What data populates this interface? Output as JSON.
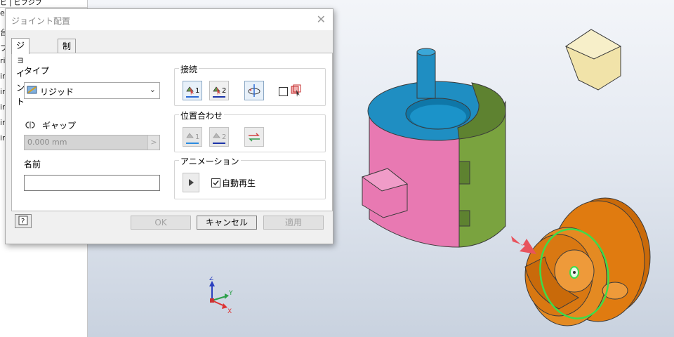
{
  "browser": {
    "top_text": "ビ | ビフジフ",
    "fragments": [
      "e",
      "台",
      "プ",
      "ri",
      "ir",
      "ir",
      "ir",
      "ir",
      "ir"
    ]
  },
  "dialog": {
    "title": "ジョイント配置",
    "close_glyph": "✕",
    "tabs": [
      {
        "label": "ジョイント",
        "active": true
      },
      {
        "label": "制限",
        "active": false
      }
    ],
    "type_label": "タイプ",
    "type_value": "リジッド",
    "gap_label": "ギャップ",
    "gap_value": "0.000 mm",
    "name_label": "名前",
    "name_value": "",
    "connect": {
      "caption": "接続",
      "btn1": "1",
      "btn2": "2"
    },
    "align": {
      "caption": "位置合わせ",
      "btn1": "1",
      "btn2": "2"
    },
    "animation": {
      "caption": "アニメーション",
      "autoplay_label": "自動再生",
      "autoplay_checked": true
    },
    "buttons": {
      "ok": "OK",
      "cancel": "キャンセル",
      "apply": "適用"
    },
    "help_glyph": "?"
  },
  "triad": {
    "z": "Z",
    "y": "Y",
    "x": "X"
  },
  "colors": {
    "pink": "#e879b2",
    "green": "#7aa33f",
    "blue": "#1f8ec2",
    "orange": "#e07b10",
    "highlight_green": "#3ddc4b",
    "arrow_red": "#e8545e",
    "cream": "#f1e3a9"
  }
}
